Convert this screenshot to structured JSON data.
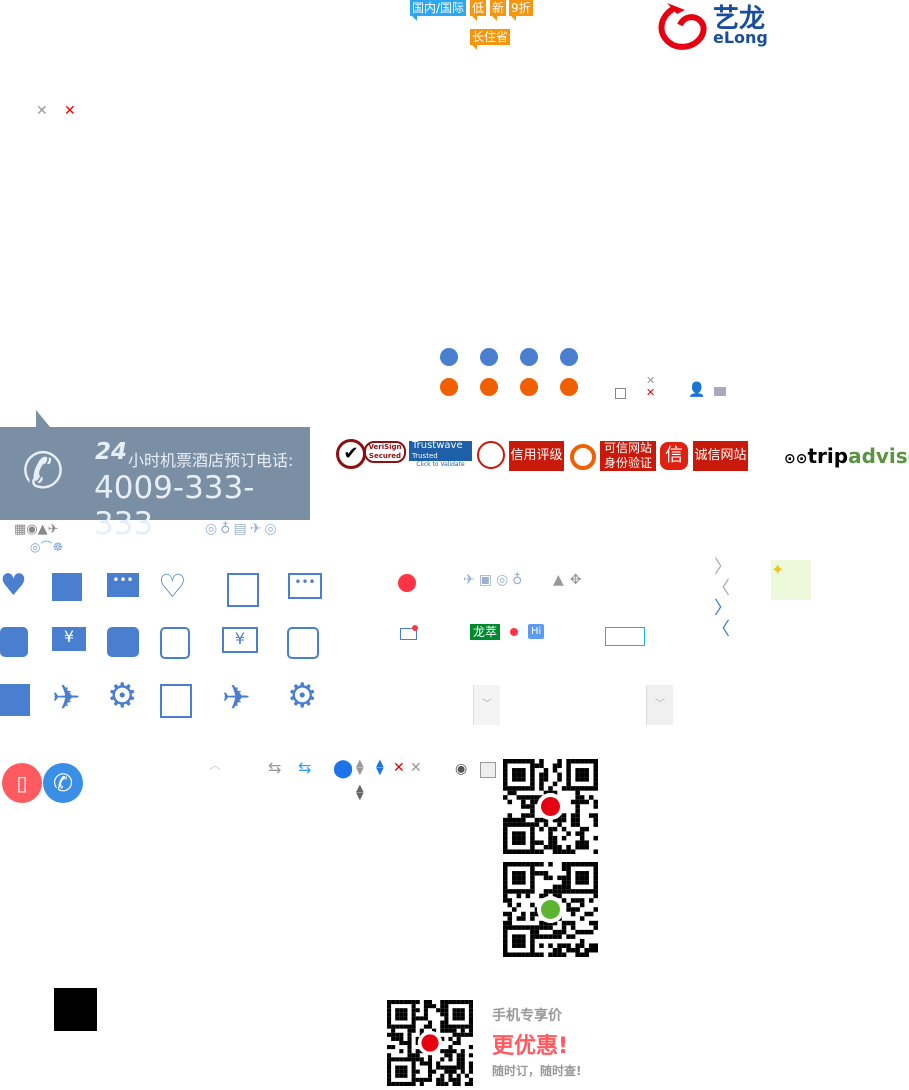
{
  "tags": {
    "domestic_intl": "国内/国际",
    "low": "低",
    "new": "新",
    "discount": "9折",
    "long_stay": "长住省"
  },
  "logo": {
    "cn": "艺龙",
    "en": "eLong"
  },
  "hotline": {
    "hours": "24",
    "label": "小时机票酒店预订电话:",
    "number": "4009-333-333"
  },
  "badges": {
    "verisign": "VeriSign Secured",
    "trustwave": "Trustwave",
    "trustwave_sub": "Trusted Commerce",
    "trustwave_click": "Click to Validate",
    "credit": "信用评级",
    "trusted_line1": "可信网站",
    "trusted_line2": "身份验证",
    "xin": "信",
    "integrity": "诚信网站",
    "tripadvisor_a": "trip",
    "tripadvisor_b": "advisor"
  },
  "misc": {
    "longcui": "龙萃",
    "hi": "Hi"
  },
  "promo": {
    "line1": "手机专享价",
    "line2": "更优惠!",
    "line3": "随时订，随时查!"
  },
  "colors": {
    "brand_red": "#e60012",
    "brand_blue": "#1a4e9c",
    "icon_blue": "#4a7fcf",
    "hotline_bg": "#7a8ea4",
    "accent_red": "#ff3344"
  }
}
